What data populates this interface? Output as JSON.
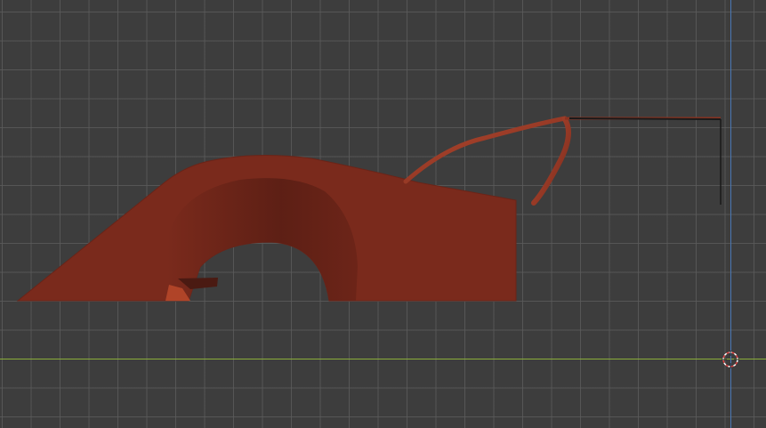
{
  "viewport": {
    "mode": "3d-viewport-side-orthographic",
    "grid_visible": true,
    "colors": {
      "background": "#3d3d3d",
      "grid": "#5a5a5a",
      "axis_x": "#8aad3a",
      "axis_z": "#4a78b5",
      "body_base": "#7a2a1c",
      "body_highlight": "#9a3320",
      "wheel_arch_shadow": "#5a1e14",
      "cursor_red": "#e04040",
      "cursor_white": "#ffffff"
    }
  },
  "objects": [
    {
      "name": "car-body-mesh",
      "material": "red-body"
    },
    {
      "name": "roll-bar-mesh",
      "material": "red-body"
    },
    {
      "name": "wing-mesh",
      "material": "dark"
    }
  ],
  "icons": {
    "cursor": "3d-cursor-icon"
  }
}
